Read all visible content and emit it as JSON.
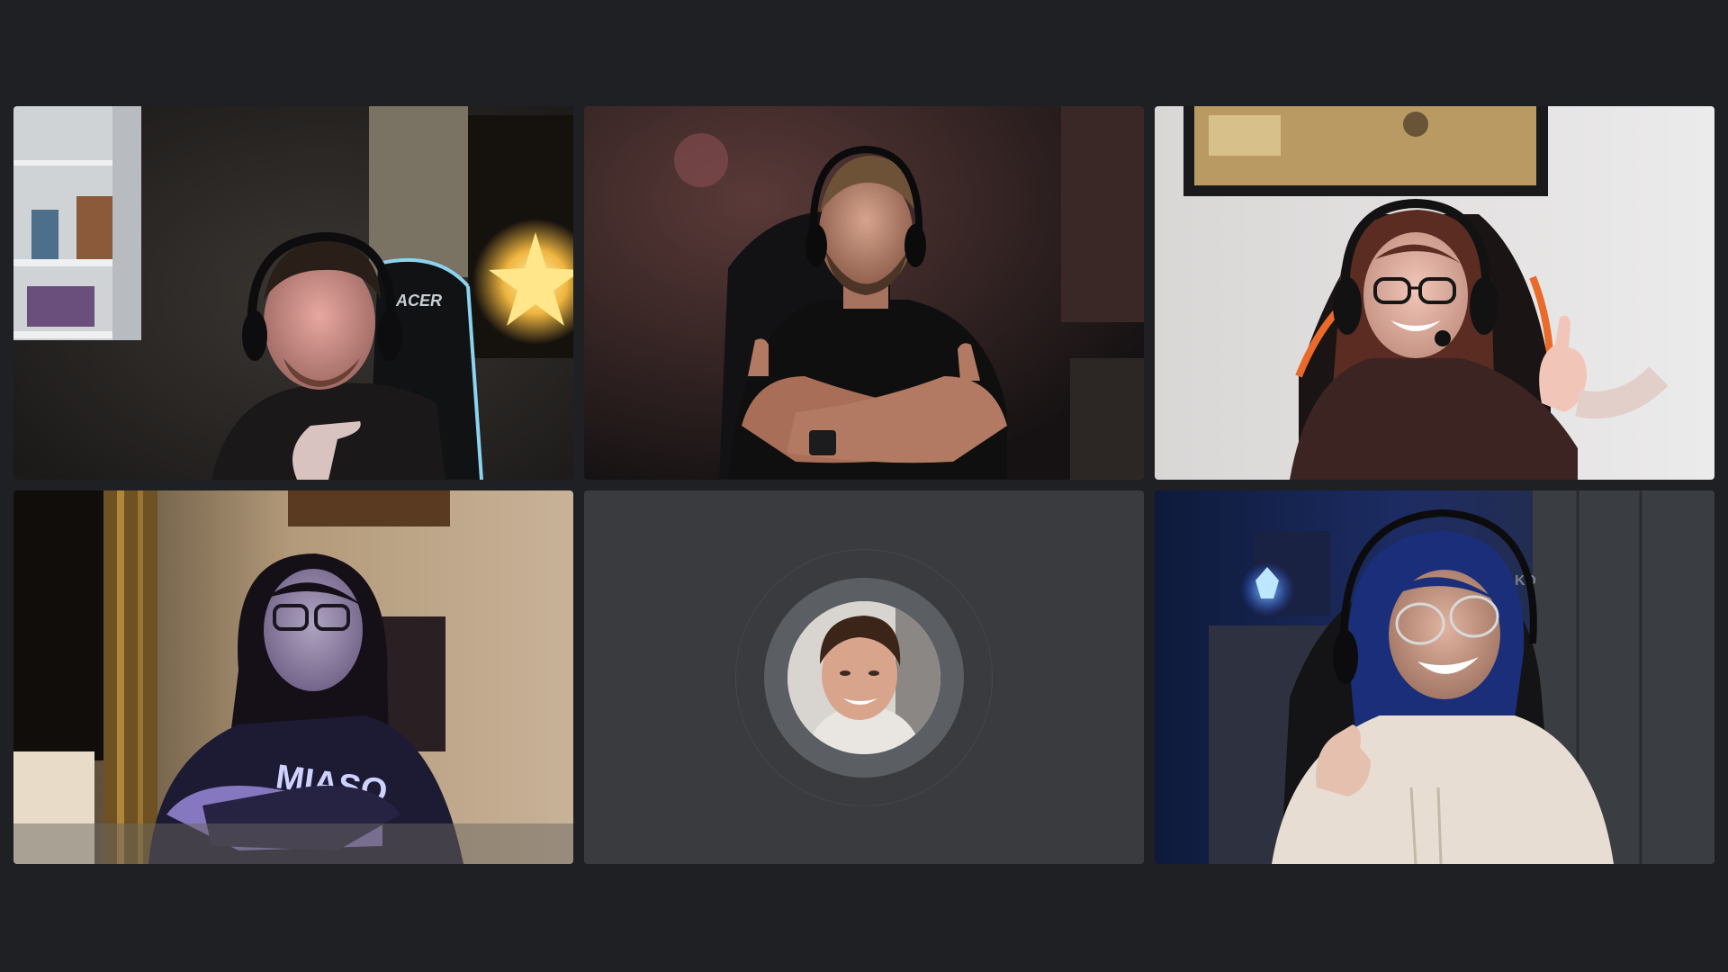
{
  "call": {
    "layout": "grid-3x2",
    "participants": [
      {
        "id": "p1",
        "video": true
      },
      {
        "id": "p2",
        "video": true
      },
      {
        "id": "p3",
        "video": true
      },
      {
        "id": "p4",
        "video": true
      },
      {
        "id": "p5",
        "video": false,
        "avatar": true
      },
      {
        "id": "p6",
        "video": true
      }
    ]
  },
  "tiles": {
    "p1": {
      "chair_logo": "ACER"
    },
    "p4": {
      "shirt_text": "MIASO"
    },
    "p6": {
      "chair_logo": "KO"
    }
  },
  "colors": {
    "background": "#1f2023",
    "avatar_tile": "#393b3e",
    "avatar_ring": "#5b5e62"
  }
}
